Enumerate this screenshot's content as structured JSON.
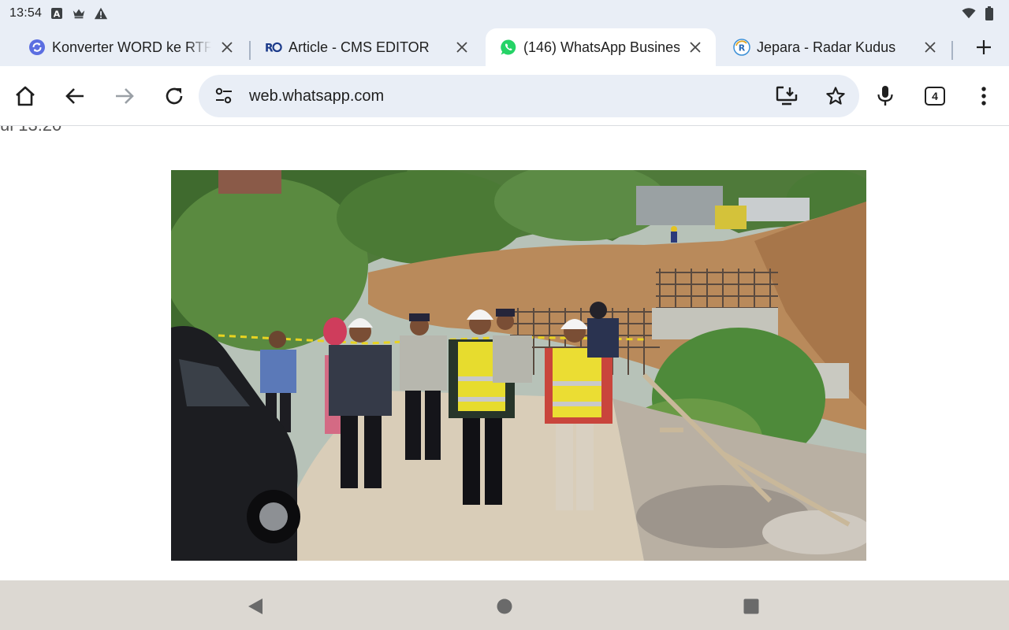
{
  "status_bar": {
    "time": "13:54",
    "icons": [
      "font-a-icon",
      "crown-icon",
      "warning-icon",
      "wifi-icon",
      "battery-icon"
    ]
  },
  "tabs": [
    {
      "title": "Konverter WORD ke RTF - ",
      "favicon": "converter-icon",
      "active": false
    },
    {
      "title": "Article - CMS EDITOR",
      "favicon": "ro-logo-icon",
      "active": false
    },
    {
      "title": "(146) WhatsApp Business",
      "favicon": "whatsapp-icon",
      "active": true
    },
    {
      "title": "Jepara - Radar Kudus",
      "favicon": "radar-kudus-icon",
      "active": false
    }
  ],
  "toolbar": {
    "url": "web.whatsapp.com",
    "tab_count": "4"
  },
  "content": {
    "partial_text": "ul 13:20"
  },
  "colors": {
    "chrome_bg": "#e9eef6",
    "whatsapp_green": "#25d366",
    "nav_bar_bg": "#dcd8d2"
  }
}
